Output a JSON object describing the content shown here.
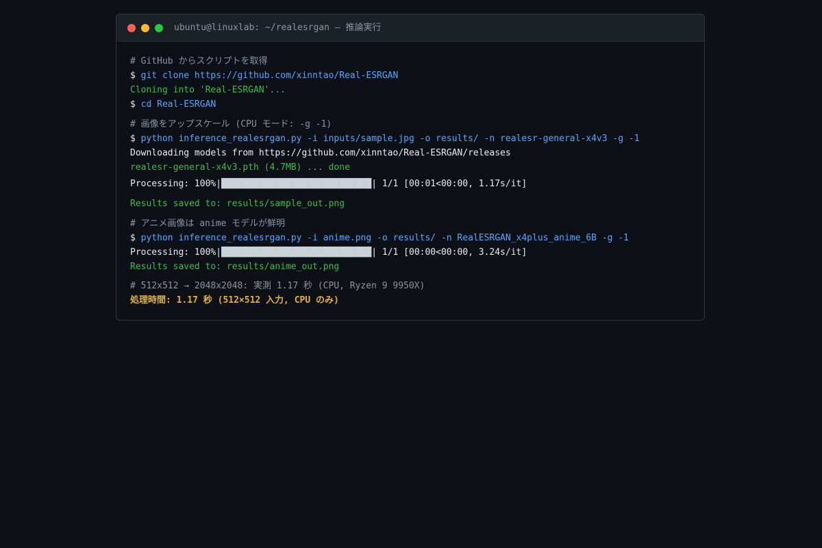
{
  "window": {
    "title": "ubuntu@linuxlab: ~/realesrgan — 推論実行",
    "colors": {
      "close": "#ff5f56",
      "minimize": "#ffbd2e",
      "maximize": "#27c93f"
    }
  },
  "terminal": {
    "prompt_symbol": "$ ",
    "comment1": "# GitHub からスクリプトを取得",
    "cmd_clone": "git clone https://github.com/xinntao/Real-ESRGAN",
    "out_cloning": "Cloning into 'Real-ESRGAN'...",
    "cmd_cd": "cd Real-ESRGAN",
    "comment2": "# 画像をアップスケール (CPU モード: -g -1)",
    "cmd_infer1": "python inference_realesrgan.py -i inputs/sample.jpg -o results/ -n realesr-general-x4v3 -g -1",
    "out_download": "Downloading models from https://github.com/xinntao/Real-ESRGAN/releases",
    "out_model_done": "realesr-general-x4v3.pth (4.7MB) ... done",
    "progress1": {
      "label": "Processing: 100%|",
      "bar": "████████████████████████████",
      "tail": "| 1/1 [00:01<00:00, 1.17s/it]",
      "percent": 100
    },
    "out_saved1": "Results saved to: results/sample_out.png",
    "comment3": "# アニメ画像は anime モデルが鮮明",
    "cmd_infer2": "python inference_realesrgan.py -i anime.png -o results/ -n RealESRGAN_x4plus_anime_6B -g -1",
    "progress2": {
      "label": "Processing: 100%|",
      "bar": "████████████████████████████",
      "tail": "| 1/1 [00:00<00:00, 3.24s/it]",
      "percent": 100
    },
    "out_saved2": "Results saved to: results/anime_out.png",
    "comment4": "# 512x512 → 2048x2048: 実測 1.17 秒 (CPU, Ryzen 9 9950X)",
    "summary": "処理時間: 1.17 秒 (512×512 入力, CPU のみ)"
  }
}
